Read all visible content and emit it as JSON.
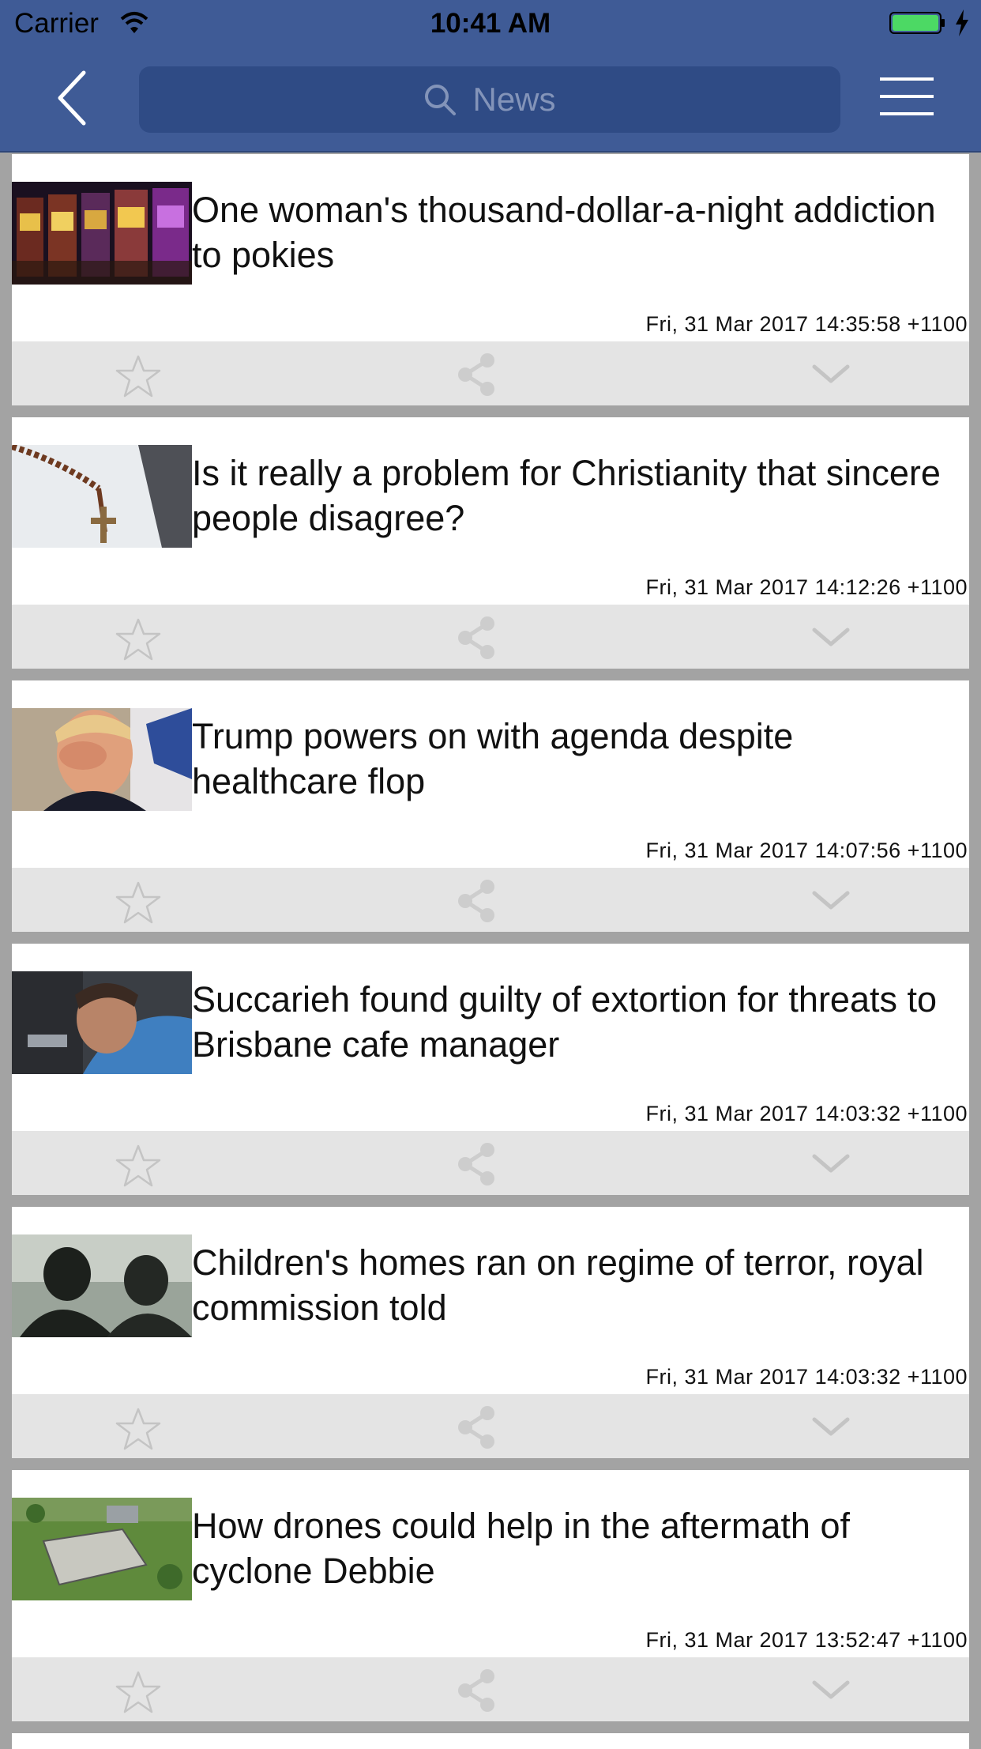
{
  "status_bar": {
    "carrier": "Carrier",
    "time": "10:41 AM"
  },
  "nav": {
    "search_placeholder": "News",
    "accent_color": "#3f5b96"
  },
  "articles": [
    {
      "headline": "One woman's thousand-dollar-a-night addiction to pokies",
      "date": "Fri, 31 Mar 2017 14:35:58 +1100",
      "thumbnail": "slot-machines-image"
    },
    {
      "headline": "Is it really a problem for Christianity that sincere people disagree?",
      "date": "Fri, 31 Mar 2017 14:12:26 +1100",
      "thumbnail": "rosary-image"
    },
    {
      "headline": "Trump powers on with agenda despite healthcare flop",
      "date": "Fri, 31 Mar 2017 14:07:56 +1100",
      "thumbnail": "trump-image"
    },
    {
      "headline": "Succarieh found guilty of extortion for threats to Brisbane cafe manager",
      "date": "Fri, 31 Mar 2017 14:03:32 +1100",
      "thumbnail": "man-in-car-image"
    },
    {
      "headline": "Children's homes ran on regime of terror, royal commission told",
      "date": "Fri, 31 Mar 2017 14:03:32 +1100",
      "thumbnail": "silhouettes-image"
    },
    {
      "headline": "How drones could help in the aftermath of cyclone Debbie",
      "date": "Fri, 31 Mar 2017 13:52:47 +1100",
      "thumbnail": "aerial-damage-image"
    }
  ]
}
